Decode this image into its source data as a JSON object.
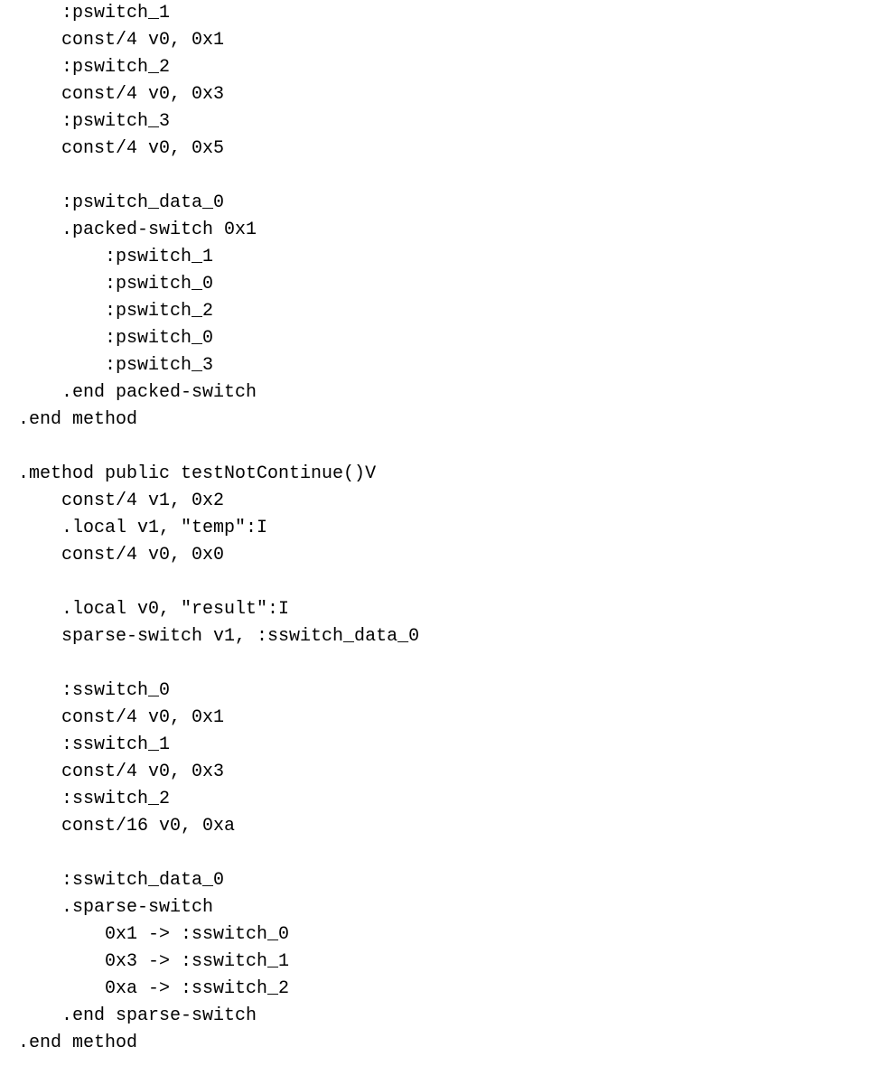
{
  "lines": [
    "    :pswitch_1",
    "    const/4 v0, 0x1",
    "    :pswitch_2",
    "    const/4 v0, 0x3",
    "    :pswitch_3",
    "    const/4 v0, 0x5",
    "",
    "    :pswitch_data_0",
    "    .packed-switch 0x1",
    "        :pswitch_1",
    "        :pswitch_0",
    "        :pswitch_2",
    "        :pswitch_0",
    "        :pswitch_3",
    "    .end packed-switch",
    ".end method",
    "",
    ".method public testNotContinue()V",
    "    const/4 v1, 0x2",
    "    .local v1, \"temp\":I",
    "    const/4 v0, 0x0",
    "",
    "    .local v0, \"result\":I",
    "    sparse-switch v1, :sswitch_data_0",
    "",
    "    :sswitch_0",
    "    const/4 v0, 0x1",
    "    :sswitch_1",
    "    const/4 v0, 0x3",
    "    :sswitch_2",
    "    const/16 v0, 0xa",
    "",
    "    :sswitch_data_0",
    "    .sparse-switch",
    "        0x1 -> :sswitch_0",
    "        0x3 -> :sswitch_1",
    "        0xa -> :sswitch_2",
    "    .end sparse-switch",
    ".end method"
  ]
}
